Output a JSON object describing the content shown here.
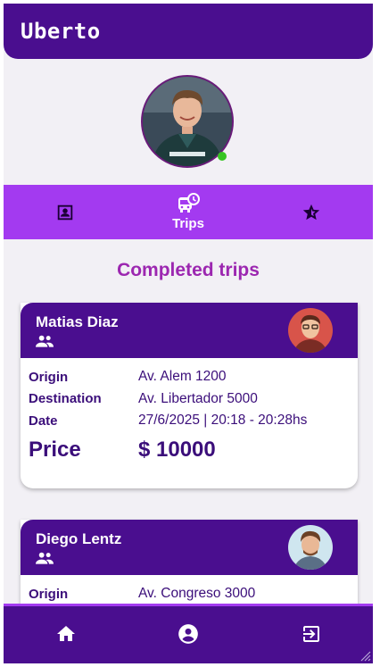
{
  "app": {
    "title": "Uberto"
  },
  "profile": {
    "status": "online"
  },
  "tabs": [
    {
      "id": "profile",
      "label": "",
      "icon": "contact-icon"
    },
    {
      "id": "trips",
      "label": "Trips",
      "icon": "bus-clock-icon",
      "active": true
    },
    {
      "id": "rating",
      "label": "",
      "icon": "star-icon"
    }
  ],
  "section": {
    "title": "Completed trips"
  },
  "labels": {
    "origin": "Origin",
    "destination": "Destination",
    "date": "Date",
    "price": "Price"
  },
  "trips": [
    {
      "driver": "Matias Diaz",
      "origin": "Av. Alem 1200",
      "destination": "Av. Libertador 5000",
      "date": "27/6/2025 | 20:18 - 20:28hs",
      "price": "$ 10000"
    },
    {
      "driver": "Diego Lentz",
      "origin": "Av. Congreso 3000"
    }
  ],
  "bottom_nav": [
    {
      "id": "home",
      "icon": "home-icon"
    },
    {
      "id": "account",
      "icon": "account-circle-icon"
    },
    {
      "id": "logout",
      "icon": "logout-icon"
    }
  ],
  "colors": {
    "primary": "#4a0e8f",
    "accent": "#a33af0",
    "title": "#9c27b0",
    "background": "#f2f0f5",
    "online": "#37c423"
  }
}
